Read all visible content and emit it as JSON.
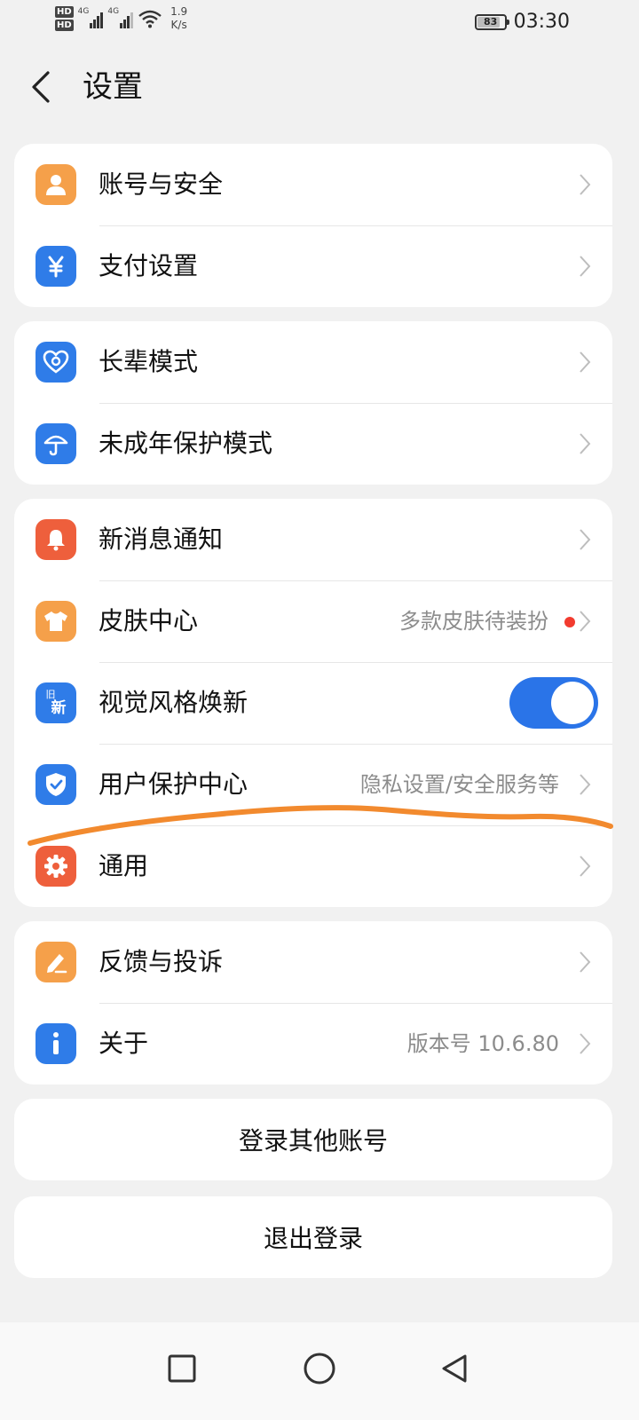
{
  "status_bar": {
    "hd1": "HD",
    "hd2": "HD",
    "net1": "4G",
    "net2": "4G",
    "speed_value": "1.9",
    "speed_unit": "K/s",
    "battery": "83",
    "time": "03:30"
  },
  "header": {
    "title": "设置"
  },
  "groups": {
    "account": [
      {
        "label": "账号与安全",
        "icon": "person-icon"
      },
      {
        "label": "支付设置",
        "icon": "yen-icon"
      }
    ],
    "modes": [
      {
        "label": "长辈模式",
        "icon": "heart-icon"
      },
      {
        "label": "未成年保护模式",
        "icon": "umbrella-icon"
      }
    ],
    "general": [
      {
        "label": "新消息通知",
        "icon": "bell-icon"
      },
      {
        "label": "皮肤中心",
        "value": "多款皮肤待装扮",
        "icon": "tshirt-icon",
        "badge": true
      },
      {
        "label": "视觉风格焕新",
        "icon": "new-style-icon",
        "toggle_on": true
      },
      {
        "label": "用户保护中心",
        "value": "隐私设置/安全服务等",
        "icon": "shield-icon"
      },
      {
        "label": "通用",
        "icon": "gear-icon"
      }
    ],
    "support": [
      {
        "label": "反馈与投诉",
        "icon": "edit-icon"
      },
      {
        "label": "关于",
        "value": "版本号 10.6.80",
        "icon": "info-icon"
      }
    ]
  },
  "new_style_icon_text": {
    "top": "旧",
    "bottom": "新"
  },
  "actions": {
    "switch_account": "登录其他账号",
    "logout": "退出登录"
  },
  "colors": {
    "orange": "#f5a04a",
    "blue": "#2f7ce8",
    "red_orange": "#ee5f3c",
    "toggle": "#2a74e8",
    "badge": "#f23b2f",
    "annotation": "#f28a2e"
  }
}
